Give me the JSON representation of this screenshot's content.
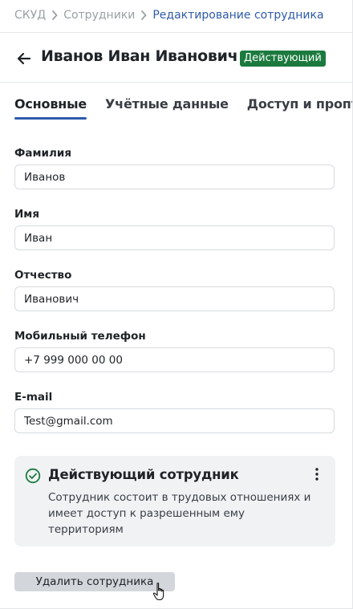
{
  "breadcrumb": {
    "items": [
      "СКУД",
      "Сотрудники"
    ],
    "current": "Редактирование сотрудника"
  },
  "header": {
    "title": "Иванов Иван Иванович",
    "badge": "Действующий",
    "badge_color": "#1b7a3e"
  },
  "tabs": [
    {
      "label": "Основные",
      "active": true
    },
    {
      "label": "Учётные данные",
      "active": false
    },
    {
      "label": "Доступ и пропуск",
      "active": false
    }
  ],
  "form": {
    "last_name": {
      "label": "Фамилия",
      "value": "Иванов"
    },
    "first_name": {
      "label": "Имя",
      "value": "Иван"
    },
    "middle_name": {
      "label": "Отчество",
      "value": "Иванович"
    },
    "phone": {
      "label": "Мобильный телефон",
      "value": "+7 999 000 00 00"
    },
    "email": {
      "label": "E-mail",
      "value": "Test@gmail.com"
    }
  },
  "status_card": {
    "title": "Действующий сотрудник",
    "description": "Сотрудник состоит в трудовых отношениях и имеет доступ к разрешенным ему территориям",
    "icon": "check-circle-icon",
    "menu_icon": "more-vertical-icon"
  },
  "actions": {
    "delete_label": "Удалить сотрудника"
  },
  "colors": {
    "accent": "#2e5aac",
    "success": "#1b7a3e",
    "card_bg": "#f0f2f4"
  }
}
